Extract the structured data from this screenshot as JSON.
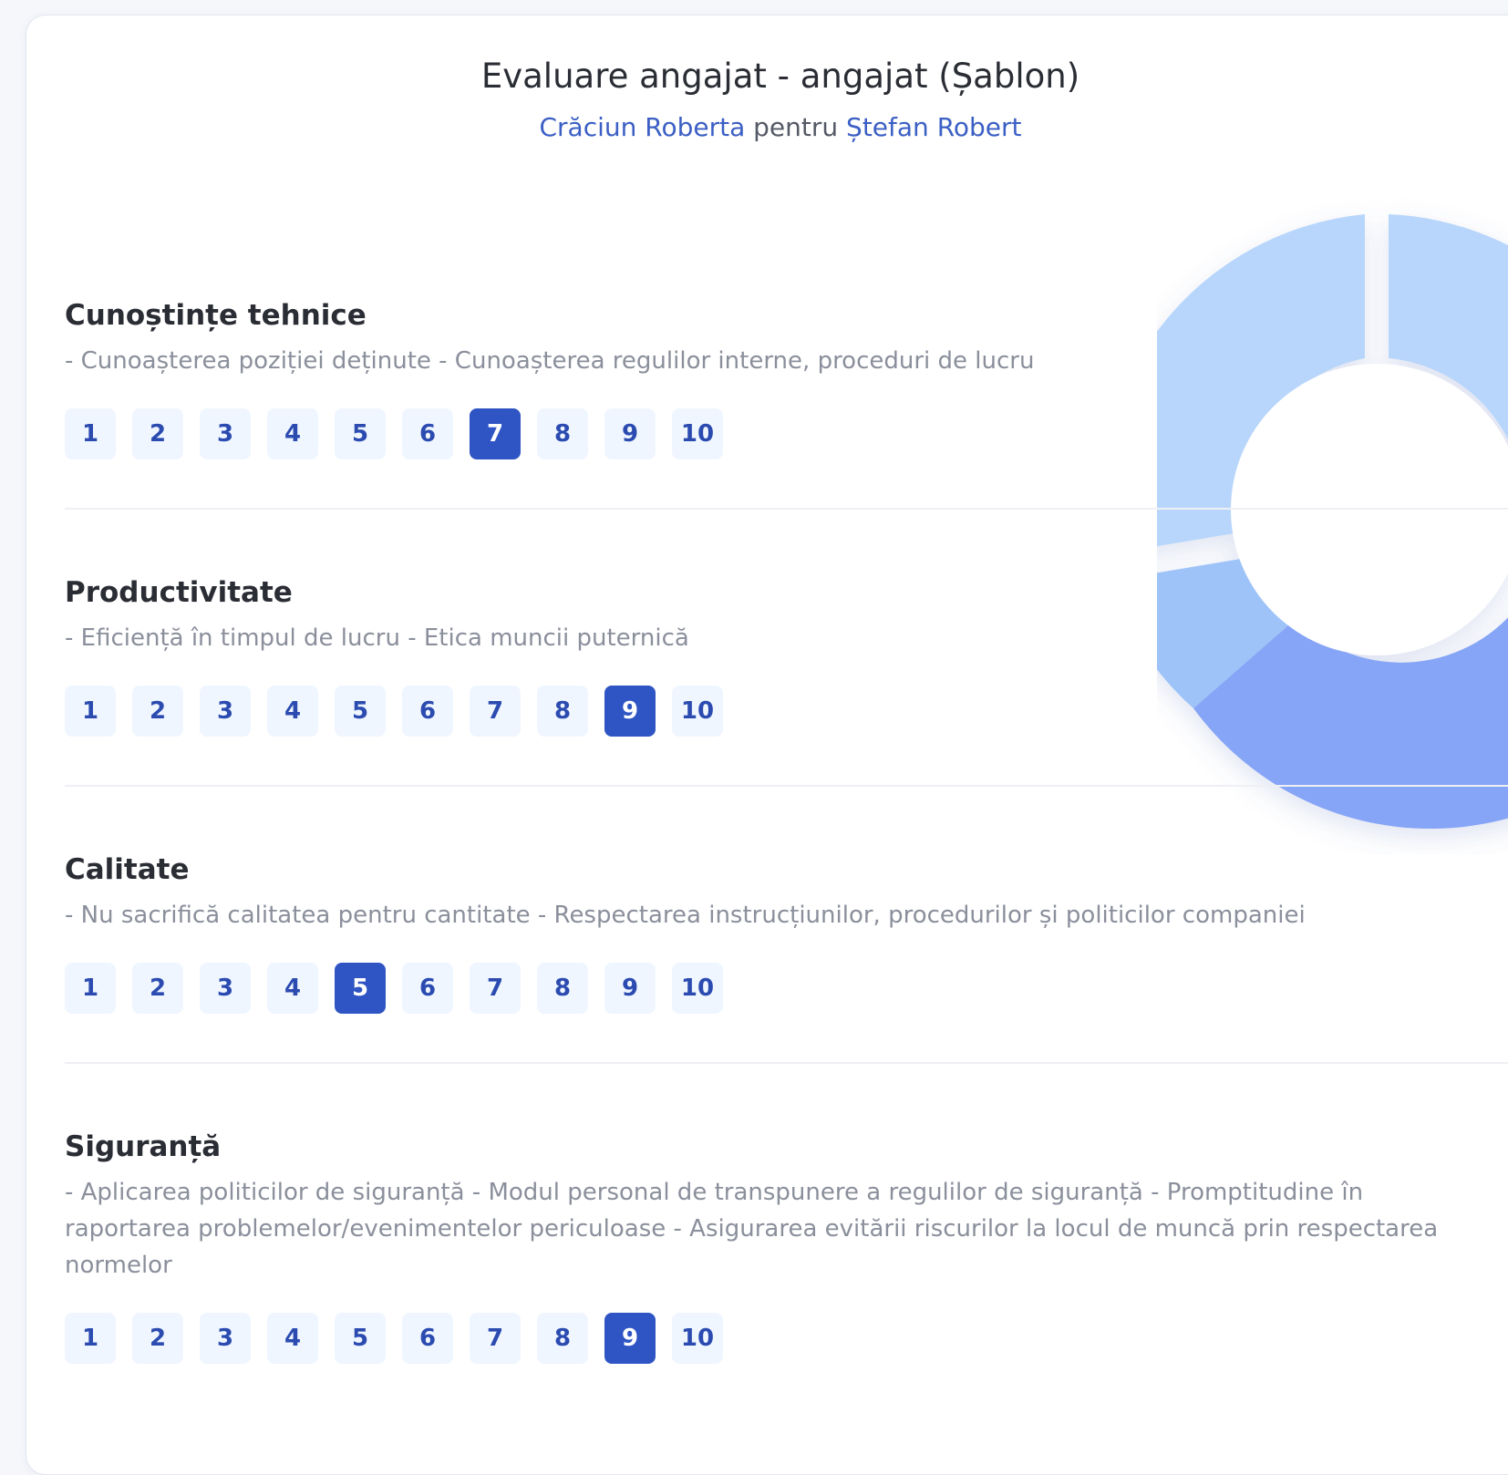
{
  "header": {
    "title": "Evaluare angajat - angajat (Șablon)",
    "evaluator": "Crăciun Roberta",
    "connector": "pentru",
    "evaluatee": "Ștefan Robert"
  },
  "scale_values": [
    "1",
    "2",
    "3",
    "4",
    "5",
    "6",
    "7",
    "8",
    "9",
    "10"
  ],
  "colors": {
    "accent": "#2f55c4",
    "score_bg": "#eff6ff",
    "donut_light": "#b8d6fb",
    "donut_mid": "#9ec3f8",
    "donut_strong": "#87a5f6"
  },
  "sections": [
    {
      "title": "Cunoștințe tehnice",
      "description": "- Cunoașterea poziției deținute - Cunoașterea regulilor interne, proceduri de lucru",
      "selected": 7
    },
    {
      "title": "Productivitate",
      "description": "- Eficiență în timpul de lucru - Etica muncii puternică",
      "selected": 9
    },
    {
      "title": "Calitate",
      "description": "- Nu sacrifică calitatea pentru cantitate - Respectarea instrucțiunilor, procedurilor și politicilor companiei",
      "selected": 5
    },
    {
      "title": "Siguranță",
      "description": "- Aplicarea politicilor de siguranță - Modul personal de transpunere a regulilor de siguranță - Promptitudine în raportarea problemelor/evenimentelor periculoase - Asigurarea evitării riscurilor la locul de muncă prin respectarea normelor",
      "selected": 9
    }
  ]
}
